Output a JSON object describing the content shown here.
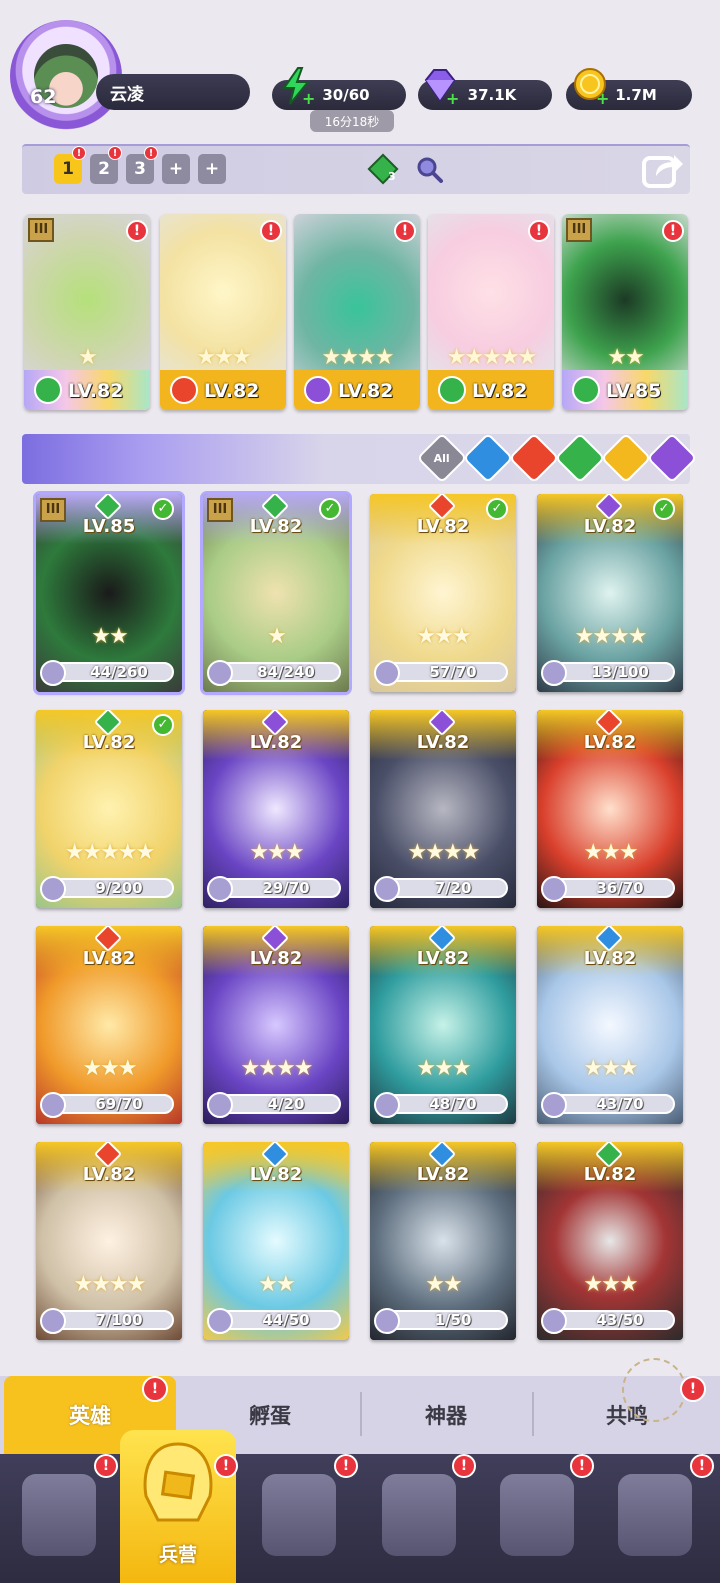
{
  "player": {
    "level": "62",
    "name": "云凌"
  },
  "resources": {
    "energy": "30/60",
    "energy_timer": "16分18秒",
    "gems": "37.1K",
    "gold": "1.7M"
  },
  "team_bar": {
    "slots": [
      "1",
      "2",
      "3",
      "+",
      "+"
    ],
    "badge": "!",
    "element_count": "3"
  },
  "team": [
    {
      "level": "LV.82",
      "stars": "★",
      "element": "wind",
      "rank": "III"
    },
    {
      "level": "LV.82",
      "stars": "★★★",
      "element": "fire"
    },
    {
      "level": "LV.82",
      "stars": "★★★★",
      "element": "moon"
    },
    {
      "level": "LV.82",
      "stars": "★★★★★",
      "element": "wind"
    },
    {
      "level": "LV.85",
      "stars": "★★",
      "element": "wind",
      "rank": "III"
    }
  ],
  "filters": {
    "all_label": "All"
  },
  "heroes": [
    {
      "level": "LV.85",
      "shards": "44/260",
      "stars": "★★",
      "element": "wind"
    },
    {
      "level": "LV.82",
      "shards": "84/240",
      "stars": "★",
      "element": "wind"
    },
    {
      "level": "LV.82",
      "shards": "57/70",
      "stars": "★★★",
      "element": "fire"
    },
    {
      "level": "LV.82",
      "shards": "13/100",
      "stars": "★★★★",
      "element": "moon"
    },
    {
      "level": "LV.82",
      "shards": "9/200",
      "stars": "★★★★★",
      "element": "wind"
    },
    {
      "level": "LV.82",
      "shards": "29/70",
      "stars": "★★★",
      "element": "moon"
    },
    {
      "level": "LV.82",
      "shards": "7/20",
      "stars": "★★★★",
      "element": "moon"
    },
    {
      "level": "LV.82",
      "shards": "36/70",
      "stars": "★★★",
      "element": "fire"
    },
    {
      "level": "LV.82",
      "shards": "69/70",
      "stars": "★★★",
      "element": "fire"
    },
    {
      "level": "LV.82",
      "shards": "4/20",
      "stars": "★★★★",
      "element": "moon"
    },
    {
      "level": "LV.82",
      "shards": "48/70",
      "stars": "★★★",
      "element": "water"
    },
    {
      "level": "LV.82",
      "shards": "43/70",
      "stars": "★★★",
      "element": "water"
    },
    {
      "level": "LV.82",
      "shards": "7/100",
      "stars": "★★★★",
      "element": "fire"
    },
    {
      "level": "LV.82",
      "shards": "44/50",
      "stars": "★★",
      "element": "water"
    },
    {
      "level": "LV.82",
      "shards": "1/50",
      "stars": "★★",
      "element": "water"
    },
    {
      "level": "LV.82",
      "shards": "43/50",
      "stars": "★★★",
      "element": "wind"
    }
  ],
  "subtabs": [
    "英雄",
    "孵蛋",
    "神器",
    "共鸣"
  ],
  "nav": {
    "active_label": "兵营"
  },
  "colors": {
    "fire": "#e8452c",
    "water": "#2f8ee0",
    "wind": "#35b24a",
    "moon": "#8c4fd8",
    "light": "#f2b81d",
    "gold_card": "#f5c628",
    "purple_card": "#9e8ee8",
    "alert": "#e8343c"
  }
}
